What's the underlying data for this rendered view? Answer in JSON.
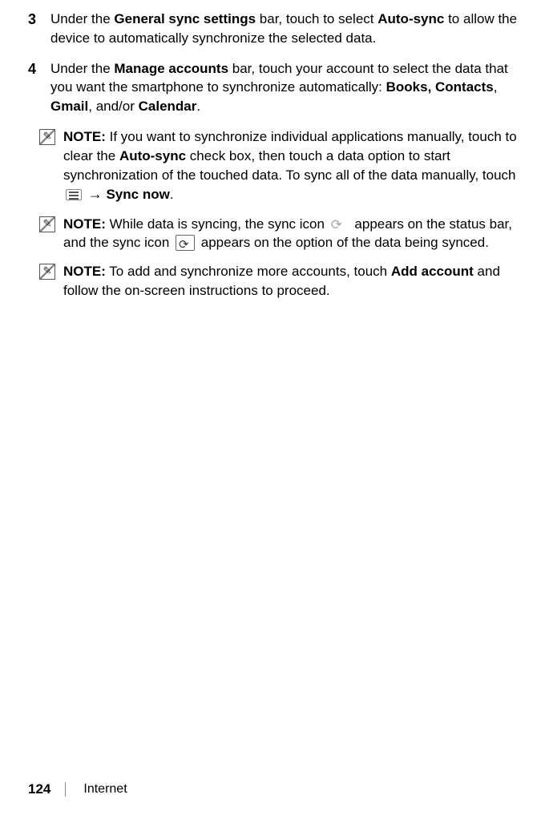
{
  "steps": [
    {
      "num": "3",
      "parts": [
        {
          "t": "Under the "
        },
        {
          "t": "General sync settings",
          "b": true
        },
        {
          "t": " bar, touch to select "
        },
        {
          "t": "Auto-sync",
          "b": true
        },
        {
          "t": " to allow the device to automatically synchronize the selected data."
        }
      ]
    },
    {
      "num": "4",
      "parts": [
        {
          "t": "Under the "
        },
        {
          "t": "Manage accounts",
          "b": true
        },
        {
          "t": " bar, touch your account to select the data that you want the smartphone to synchronize automatically: "
        },
        {
          "t": "Books, Contacts",
          "b": true
        },
        {
          "t": ", "
        },
        {
          "t": "Gmail",
          "b": true
        },
        {
          "t": ", and/or "
        },
        {
          "t": "Calendar",
          "b": true
        },
        {
          "t": "."
        }
      ]
    }
  ],
  "notes": [
    {
      "parts": [
        {
          "t": "NOTE:",
          "b": true
        },
        {
          "t": " If you want to synchronize individual applications manually, touch to clear the "
        },
        {
          "t": "Auto-sync",
          "b": true
        },
        {
          "t": " check box, then touch a data option to start synchronization of the touched data. To sync all of the data manually, touch "
        },
        {
          "icon": "menu"
        },
        {
          "t": " "
        },
        {
          "arrow": "→"
        },
        {
          "t": " "
        },
        {
          "t": "Sync now",
          "b": true
        },
        {
          "t": "."
        }
      ]
    },
    {
      "parts": [
        {
          "t": "NOTE:",
          "b": true
        },
        {
          "t": " While data is syncing, the sync icon "
        },
        {
          "icon": "sync-light"
        },
        {
          "t": " appears on the status bar, and the sync icon "
        },
        {
          "icon": "sync-boxed"
        },
        {
          "t": " appears on the option of the data being synced."
        }
      ]
    },
    {
      "parts": [
        {
          "t": "NOTE:",
          "b": true
        },
        {
          "t": " To add and synchronize more accounts, touch "
        },
        {
          "t": "Add account",
          "b": true
        },
        {
          "t": " and follow the on-screen instructions to proceed."
        }
      ]
    }
  ],
  "footer": {
    "page": "124",
    "section": "Internet"
  }
}
